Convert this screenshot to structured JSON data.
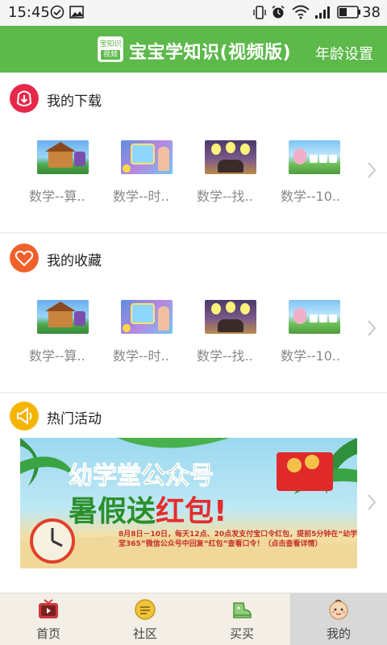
{
  "status_bar": {
    "time": "15:45",
    "battery_level": "38",
    "icons": [
      "check-circle-icon",
      "image-icon",
      "vibrate-icon",
      "alarm-icon",
      "wifi-icon",
      "signal-icon",
      "battery-icon"
    ]
  },
  "app_bar": {
    "logo_line1": "宝知识",
    "logo_line2": "视频",
    "title": "宝宝学知识(视频版)",
    "age_setting": "年龄设置",
    "bg_color": "#5cb94a"
  },
  "downloads": {
    "title": "我的下载",
    "icon": "download-icon",
    "icon_color": "#e8284a",
    "items": [
      {
        "label": "数学--算..",
        "thumb": "cottage-scene"
      },
      {
        "label": "数学--时..",
        "thumb": "clock-scene"
      },
      {
        "label": "数学--找..",
        "thumb": "lightbulb-scene"
      },
      {
        "label": "数学--10..",
        "thumb": "bunny-scene"
      }
    ]
  },
  "favorites": {
    "title": "我的收藏",
    "icon": "heart-icon",
    "icon_color": "#f0602a",
    "items": [
      {
        "label": "数学--算..",
        "thumb": "cottage-scene"
      },
      {
        "label": "数学--时..",
        "thumb": "clock-scene"
      },
      {
        "label": "数学--找..",
        "thumb": "lightbulb-scene"
      },
      {
        "label": "数学--10..",
        "thumb": "bunny-scene"
      }
    ]
  },
  "activities": {
    "title": "热门活动",
    "icon": "megaphone-icon",
    "icon_color": "#f5b400",
    "banner": {
      "title_line1": "幼学堂公众号",
      "title_line2a": "暑假送",
      "title_line2b": "红包",
      "title_line2c": "!",
      "desc": "8月8日－10日，每天12点、20点发支付宝口令红包，提前5分钟在“幼学堂365”微信公众号中回复“红包”查看口令！（点击查看详情）"
    }
  },
  "bottom_nav": {
    "items": [
      {
        "label": "首页",
        "icon": "tv-icon"
      },
      {
        "label": "社区",
        "icon": "chat-bubble-icon"
      },
      {
        "label": "买买",
        "icon": "shoe-icon"
      },
      {
        "label": "我的",
        "icon": "baby-face-icon"
      }
    ],
    "active_index": 3
  }
}
